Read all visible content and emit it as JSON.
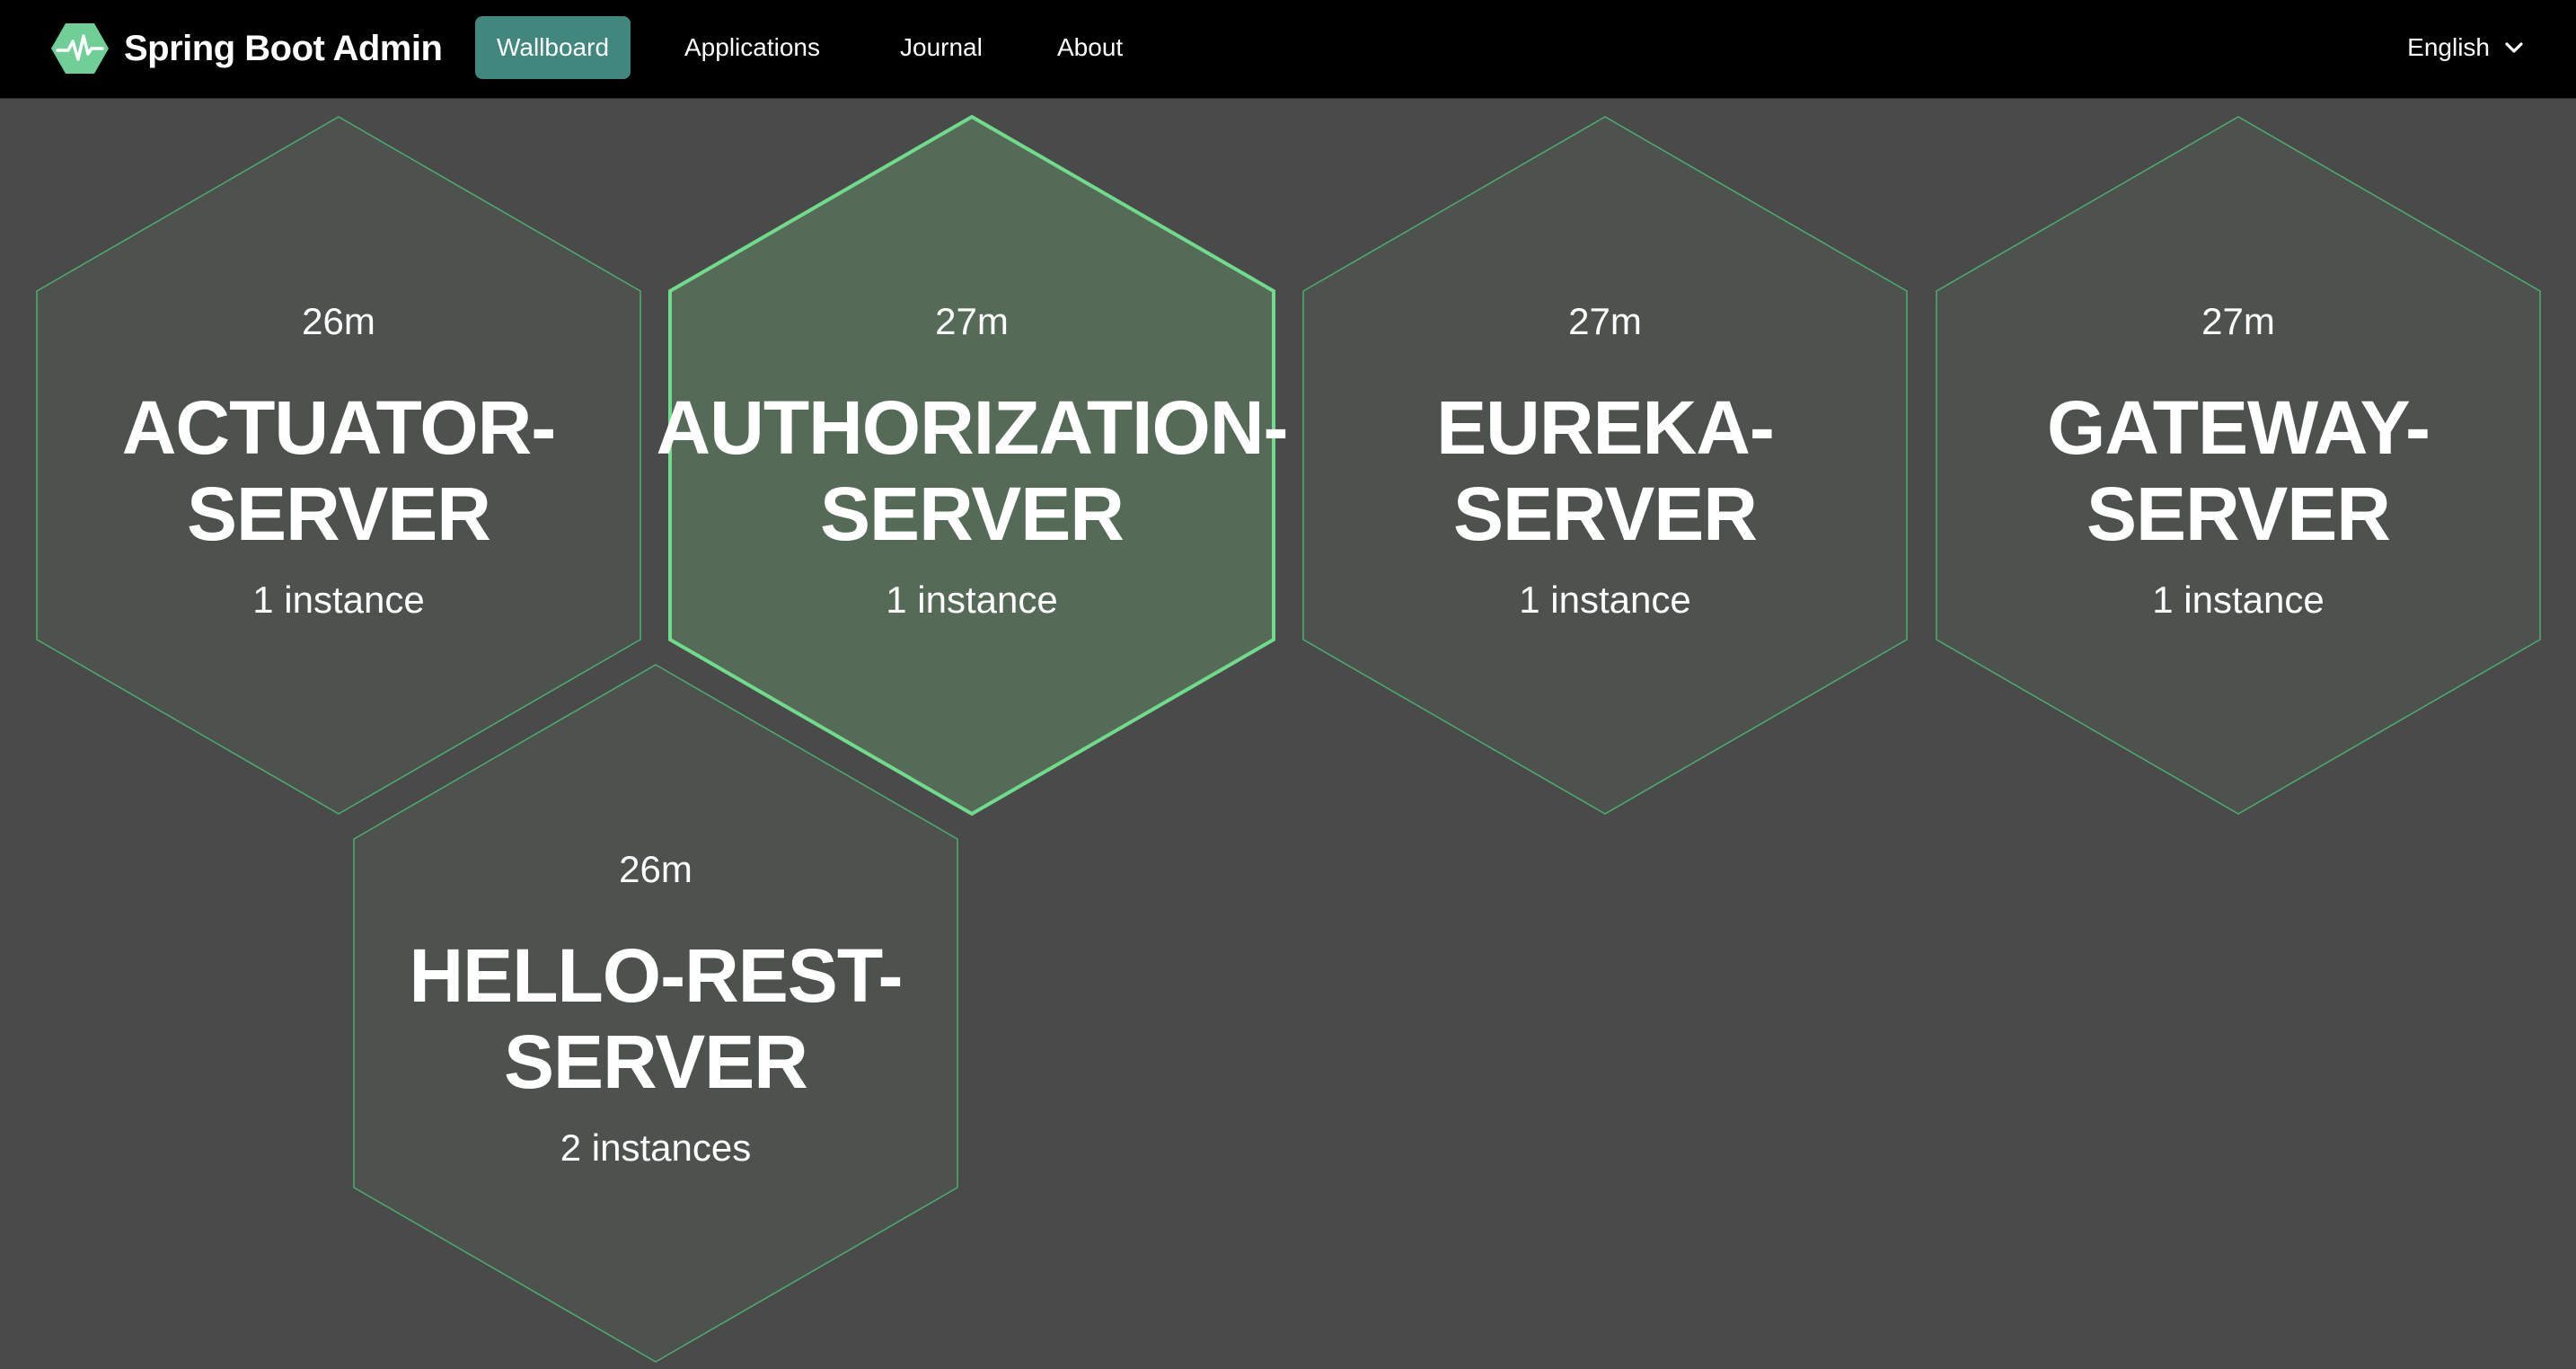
{
  "brand": {
    "title": "Spring Boot Admin",
    "logo_icon": "heartbeat-hexagon-icon",
    "logo_color": "#6fcf97"
  },
  "nav": {
    "items": [
      {
        "label": "Wallboard",
        "active": true
      },
      {
        "label": "Applications",
        "active": false
      },
      {
        "label": "Journal",
        "active": false
      },
      {
        "label": "About",
        "active": false
      }
    ],
    "language": "English",
    "language_icon": "chevron-down-icon"
  },
  "colors": {
    "accent": "#42877e",
    "up_border": "#4cae6e",
    "highlight_border": "#6fdc8c",
    "tile_fill": "#4e524f",
    "highlight_fill": "#556b58",
    "background": "#4a4a4a"
  },
  "applications": [
    {
      "uptime": "26m",
      "name_line1": "ACTUATOR-",
      "name_line2": "SERVER",
      "instances": "1 instance",
      "highlighted": false
    },
    {
      "uptime": "27m",
      "name_line1": "AUTHORIZATION-",
      "name_line2": "SERVER",
      "instances": "1 instance",
      "highlighted": true
    },
    {
      "uptime": "27m",
      "name_line1": "EUREKA-",
      "name_line2": "SERVER",
      "instances": "1 instance",
      "highlighted": false
    },
    {
      "uptime": "27m",
      "name_line1": "GATEWAY-",
      "name_line2": "SERVER",
      "instances": "1 instance",
      "highlighted": false
    },
    {
      "uptime": "26m",
      "name_line1": "HELLO-REST-",
      "name_line2": "SERVER",
      "instances": "2 instances",
      "highlighted": false
    }
  ]
}
